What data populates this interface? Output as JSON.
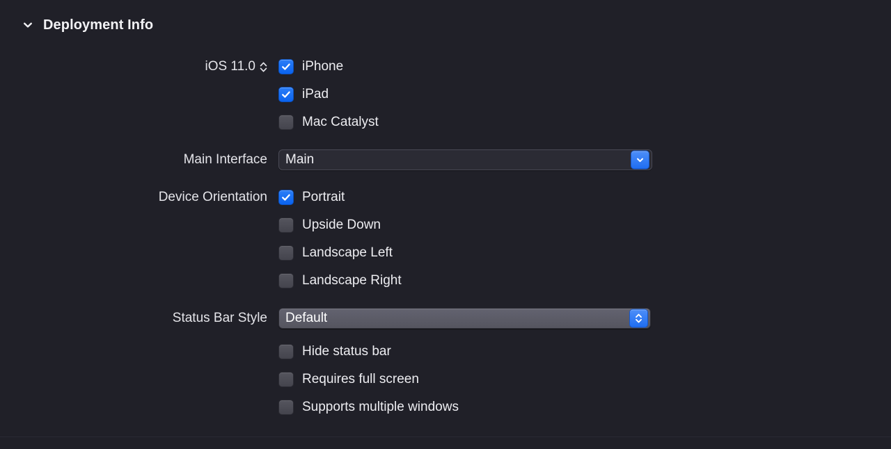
{
  "section": {
    "title": "Deployment Info",
    "disclosure_icon": "chevron-down-icon",
    "expanded": true
  },
  "colors": {
    "background": "#202028",
    "text": "#e8e8ec",
    "accent_blue": "#1a6ff5",
    "checkbox_off": "#4e4e57",
    "field_dark": "#2b2b34",
    "field_light": "#5a5a64",
    "divider": "#2a2a33"
  },
  "deployment_target": {
    "label": "iOS 11.0",
    "stepper_icon": "stepper-up-down-icon"
  },
  "targeted_devices": [
    {
      "label": "iPhone",
      "checked": true
    },
    {
      "label": "iPad",
      "checked": true
    },
    {
      "label": "Mac Catalyst",
      "checked": false
    }
  ],
  "main_interface": {
    "label": "Main Interface",
    "value": "Main",
    "button_icon": "chevron-down-icon"
  },
  "device_orientation": {
    "label": "Device Orientation",
    "options": [
      {
        "label": "Portrait",
        "checked": true
      },
      {
        "label": "Upside Down",
        "checked": false
      },
      {
        "label": "Landscape Left",
        "checked": false
      },
      {
        "label": "Landscape Right",
        "checked": false
      }
    ]
  },
  "status_bar_style": {
    "label": "Status Bar Style",
    "value": "Default",
    "button_icon": "chevron-up-down-icon"
  },
  "status_bar_options": [
    {
      "label": "Hide status bar",
      "checked": false
    },
    {
      "label": "Requires full screen",
      "checked": false
    },
    {
      "label": "Supports multiple windows",
      "checked": false
    }
  ]
}
